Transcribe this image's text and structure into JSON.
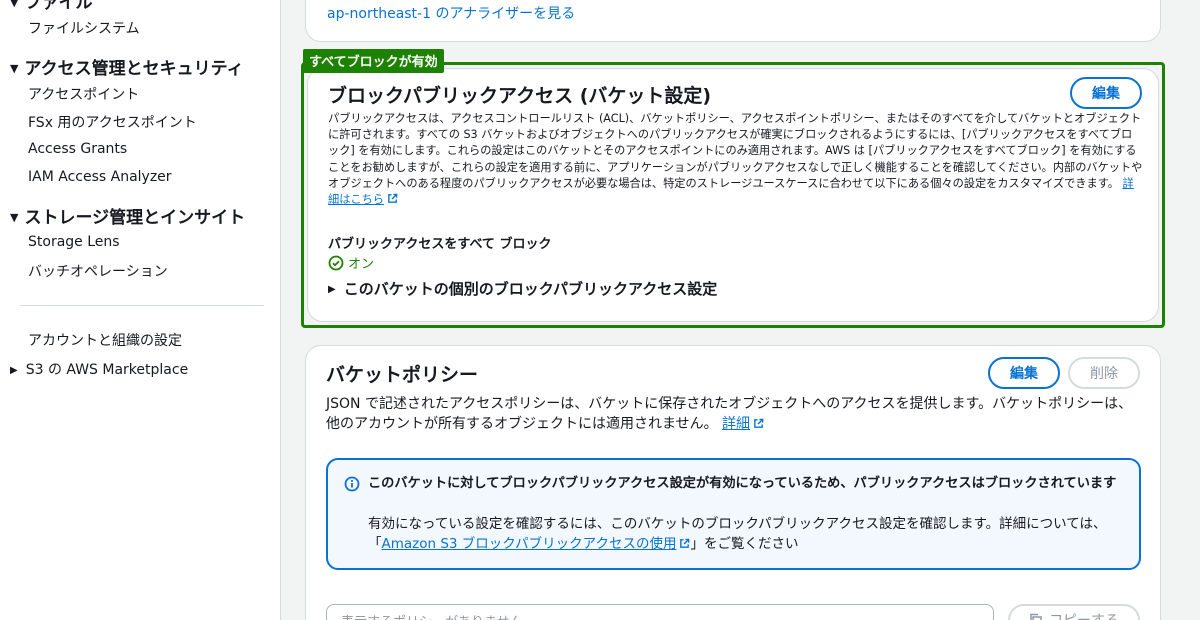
{
  "sidebar": {
    "cut_heading": "ファイル",
    "cut_item": "ファイルシステム",
    "section_access": {
      "heading": "アクセス管理とセキュリティ",
      "items": [
        "アクセスポイント",
        "FSx 用のアクセスポイント",
        "Access Grants",
        "IAM Access Analyzer"
      ]
    },
    "section_storage": {
      "heading": "ストレージ管理とインサイト",
      "items": [
        "Storage Lens",
        "バッチオペレーション"
      ]
    },
    "account_settings": "アカウントと組織の設定",
    "marketplace": "S3 の AWS Marketplace"
  },
  "top_panel": {
    "analyzer_link": "ap-northeast-1 のアナライザーを見る"
  },
  "block_public_access": {
    "badge": "すべてブロックが有効",
    "title": "ブロックパブリックアクセス (バケット設定)",
    "edit_label": "編集",
    "description": "パブリックアクセスは、アクセスコントロールリスト (ACL)、バケットポリシー、アクセスポイントポリシー、またはそのすべてを介してバケットとオブジェクトに許可されます。すべての S3 バケットおよびオブジェクトへのパブリックアクセスが確実にブロックされるようにするには、[パブリックアクセスをすべてブロック] を有効にします。これらの設定はこのバケットとそのアクセスポイントにのみ適用されます。AWS は [パブリックアクセスをすべてブロック] を有効にすることをお勧めしますが、これらの設定を適用する前に、アプリケーションがパブリックアクセスなしで正しく機能することを確認してください。内部のバケットやオブジェクトへのある程度のパブリックアクセスが必要な場合は、特定のストレージユースケースに合わせて以下にある個々の設定をカスタマイズできます。",
    "learn_more": "詳細はこちら",
    "setting_label": "パブリックアクセスをすべて ブロック",
    "setting_status": "オン",
    "expand_label": "このバケットの個別のブロックパブリックアクセス設定"
  },
  "bucket_policy": {
    "title": "バケットポリシー",
    "edit_label": "編集",
    "delete_label": "削除",
    "description": "JSON で記述されたアクセスポリシーは、バケットに保存されたオブジェクトへのアクセスを提供します。バケットポリシーは、他のアカウントが所有するオブジェクトには適用されません。",
    "details_link": "詳細",
    "info_title": "このバケットに対してブロックパブリックアクセス設定が有効になっているため、パブリックアクセスはブロックされています",
    "info_text_before": "有効になっている設定を確認するには、このバケットのブロックパブリックアクセス設定を確認します。詳細については、「",
    "info_link": "Amazon S3 ブロックパブリックアクセスの使用",
    "info_text_after": "」をご覧ください",
    "policy_placeholder": "表示するポリシーがありません",
    "copy_label": "コピーする"
  },
  "colors": {
    "accent": "#0972d3",
    "success": "#1d8102",
    "border": "#d5dbdb"
  }
}
